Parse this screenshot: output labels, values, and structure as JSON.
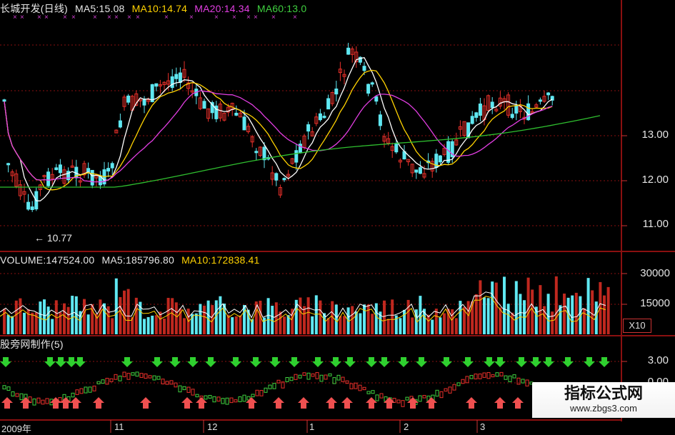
{
  "header": {
    "title": "长城开发(日线)",
    "ma5": "MA5:15.08",
    "ma10": "MA10:14.74",
    "ma20": "MA20:14.34",
    "ma60": "MA60:13.0"
  },
  "price_axis": [
    "13.00",
    "12.00",
    "11.00"
  ],
  "low_annotation": "10.77",
  "volume_header": {
    "volume": "VOLUME:147524.00",
    "ma5": "MA5:185796.80",
    "ma10": "MA10:172838.41"
  },
  "volume_axis": [
    "30000",
    "15000"
  ],
  "volume_scale": "X10",
  "indicator_header": "股旁网制作(5)",
  "indicator_axis": [
    "3.00",
    "0.00"
  ],
  "x_axis": [
    "2009年",
    "11",
    "12",
    "1",
    "2",
    "3"
  ],
  "watermark": {
    "title": "指标公式网",
    "url": "www.zbgs3.com"
  },
  "colors": {
    "up": "#e8302a",
    "down": "#5fe8f2",
    "ma5": "#ffffff",
    "ma10": "#ffd200",
    "ma20": "#e23ee2",
    "ma60": "#2fbf2f",
    "grid": "#8a1010"
  }
}
